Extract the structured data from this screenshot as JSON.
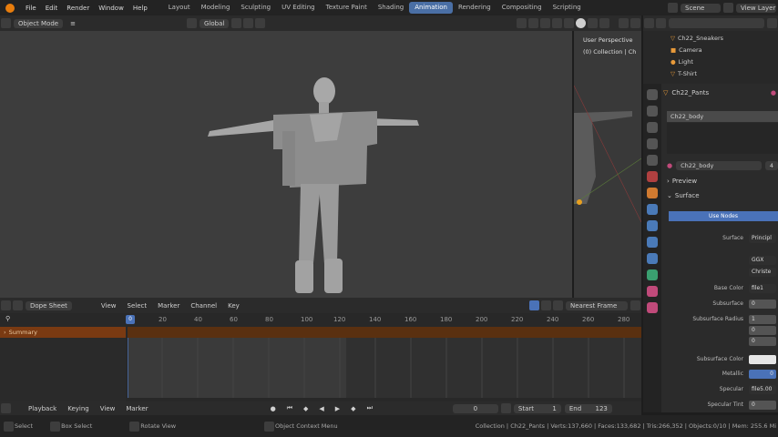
{
  "topbar": {
    "menus": [
      "File",
      "Edit",
      "Render",
      "Window",
      "Help"
    ],
    "workspaces": [
      "Layout",
      "Modeling",
      "Sculpting",
      "UV Editing",
      "Texture Paint",
      "Shading",
      "Animation",
      "Rendering",
      "Compositing",
      "Scripting"
    ],
    "active_workspace": "Animation",
    "scene": "Scene",
    "view_layer": "View Layer"
  },
  "viewport_header": {
    "mode": "Object Mode",
    "orientation": "Global"
  },
  "side_viewport": {
    "text_line1": "User Perspective",
    "text_line2": "(0) Collection | Ch"
  },
  "outliner": {
    "items": [
      {
        "label": "Ch22_Sneakers",
        "icon": "mesh-icon"
      },
      {
        "label": "Camera",
        "icon": "camera-icon"
      },
      {
        "label": "Light",
        "icon": "light-icon"
      },
      {
        "label": "T-Shirt",
        "icon": "mesh-icon"
      }
    ]
  },
  "properties": {
    "object_name": "Ch22_Pants",
    "material_slot": "Ch22_body",
    "material_name": "Ch22_body",
    "user_count": "4",
    "preview_label": "Preview",
    "surface_label": "Surface",
    "use_nodes_label": "Use Nodes",
    "surface_field_label": "Surface",
    "surface_field_value": "Principl",
    "distribution": "GGX",
    "subsurface_method": "Christe",
    "rows": [
      {
        "label": "Base Color",
        "value": "file1"
      },
      {
        "label": "Subsurface",
        "value": "0"
      },
      {
        "label": "Subsurface Radius",
        "value": "1"
      },
      {
        "label": "",
        "value": "0"
      },
      {
        "label": "",
        "value": "0"
      },
      {
        "label": "Subsurface Color",
        "value": ""
      },
      {
        "label": "Metallic",
        "value": "0"
      },
      {
        "label": "Specular",
        "value": "file5.00"
      },
      {
        "label": "Specular Tint",
        "value": "0"
      }
    ]
  },
  "dopesheet": {
    "editor": "Dope Sheet",
    "menus": [
      "View",
      "Select",
      "Marker",
      "Channel",
      "Key"
    ],
    "snap": "Nearest Frame",
    "current_frame_badge": "0",
    "ticks": [
      "20",
      "40",
      "60",
      "80",
      "100",
      "120",
      "140",
      "160",
      "180",
      "200",
      "220",
      "240",
      "260",
      "280"
    ],
    "summary_label": "Summary"
  },
  "timeline": {
    "menus": [
      "Playback",
      "Keying",
      "View",
      "Marker"
    ],
    "current_frame": "0",
    "start_label": "Start",
    "start_value": "1",
    "end_label": "End",
    "end_value": "123"
  },
  "statusbar": {
    "select": "Select",
    "box_select": "Box Select",
    "rotate_view": "Rotate View",
    "context_menu": "Object Context Menu",
    "stats": "Collection | Ch22_Pants | Verts:137,660 | Faces:133,682 | Tris:266,352 | Objects:0/10 | Mem: 255.6 Mi"
  }
}
